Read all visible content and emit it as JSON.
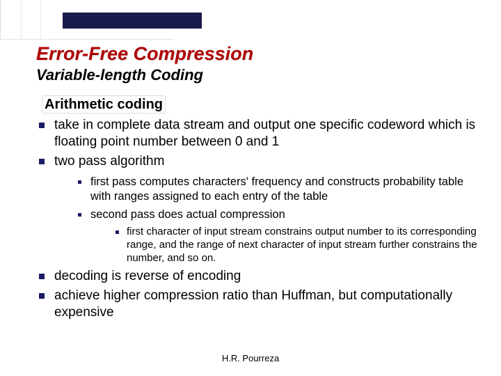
{
  "title": "Error-Free Compression",
  "subtitle": "Variable-length Coding",
  "section_heading": "Arithmetic coding",
  "bullets": {
    "b1": "take in complete data stream and output one specific codeword which is floating point number between 0 and 1",
    "b2": "two pass algorithm",
    "b2_sub1": "first pass computes characters' frequency and constructs probability table with ranges assigned to each entry of the table",
    "b2_sub2": "second pass does actual compression",
    "b2_sub2_sub1": "first character of input stream constrains output number to its corresponding range, and the range of next character of input stream further constrains the number, and so on.",
    "b3": "decoding is reverse of encoding",
    "b4": "achieve higher compression ratio than Huffman, but computationally expensive"
  },
  "footer": "H.R. Pourreza"
}
